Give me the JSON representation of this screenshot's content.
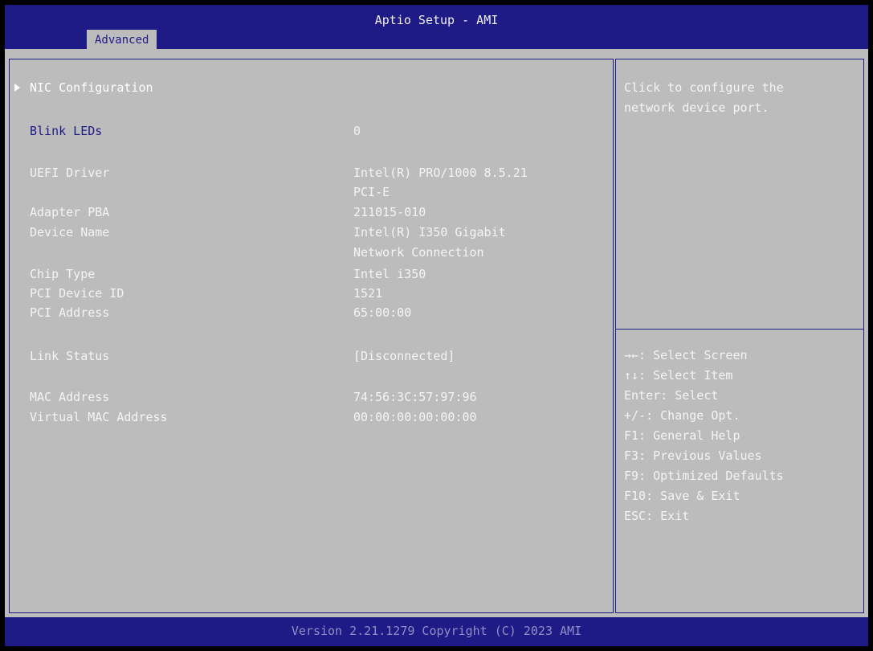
{
  "header": {
    "title": "Aptio Setup - AMI",
    "tab": "Advanced"
  },
  "menu": {
    "nic_configuration": "NIC Configuration",
    "blink_leds": {
      "label": "Blink LEDs",
      "value": "0"
    },
    "uefi_driver": {
      "label": "UEFI Driver",
      "value_line1": "Intel(R) PRO/1000 8.5.21",
      "value_line2": "PCI-E"
    },
    "adapter_pba": {
      "label": "Adapter PBA",
      "value": "211015-010"
    },
    "device_name": {
      "label": "Device Name",
      "value_line1": "Intel(R) I350 Gigabit",
      "value_line2": "Network Connection"
    },
    "chip_type": {
      "label": "Chip Type",
      "value": "Intel i350"
    },
    "pci_device_id": {
      "label": "PCI Device ID",
      "value": "1521"
    },
    "pci_address": {
      "label": "PCI Address",
      "value": "65:00:00"
    },
    "link_status": {
      "label": "Link Status",
      "value": "[Disconnected]"
    },
    "mac_address": {
      "label": "MAC Address",
      "value": "74:56:3C:57:97:96"
    },
    "virtual_mac_address": {
      "label": "Virtual MAC Address",
      "value": "00:00:00:00:00:00"
    }
  },
  "help": {
    "description_line1": "Click to configure the",
    "description_line2": "network device port.",
    "keys": [
      "→←: Select Screen",
      "↑↓: Select Item",
      "Enter: Select",
      "+/-: Change Opt.",
      "F1: General Help",
      "F3: Previous Values",
      "F9: Optimized Defaults",
      "F10: Save & Exit",
      "ESC: Exit"
    ]
  },
  "footer": {
    "version": "Version 2.21.1279 Copyright (C) 2023 AMI"
  },
  "colors": {
    "accent_blue": "#1e1a86",
    "panel_gray": "#bcbcbc",
    "highlight_white": "#ffffff"
  },
  "icons": {
    "submenu_marker": "triangle-right-icon"
  }
}
